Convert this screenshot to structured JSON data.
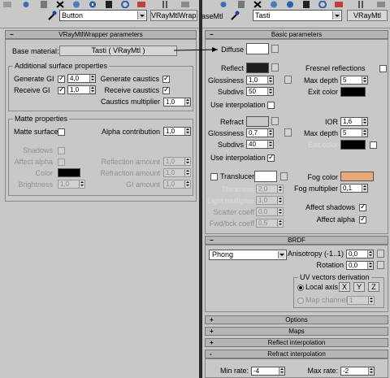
{
  "left": {
    "toolbar": {
      "name": "Button",
      "type_button": "VRayMtlWrapp"
    },
    "rollout_title": "VRayMtlWrapper parameters",
    "base_material": {
      "label": "Base material:",
      "button": "Tasti  ( VRayMtl )"
    },
    "additional": {
      "title": "Additional surface properties",
      "generate_gi": {
        "label": "Generate GI",
        "checked": true,
        "value": "4,0"
      },
      "receive_gi": {
        "label": "Receive GI",
        "checked": true,
        "value": "1,0"
      },
      "generate_caustics": {
        "label": "Generate caustics",
        "checked": true
      },
      "receive_caustics": {
        "label": "Receive caustics",
        "checked": true
      },
      "caustics_multiplier": {
        "label": "Caustics multiplier",
        "value": "1,0"
      }
    },
    "matte": {
      "title": "Matte properties",
      "matte_surface": {
        "label": "Matte surface",
        "checked": false
      },
      "alpha_contribution": {
        "label": "Alpha contribution",
        "value": "1,0"
      },
      "shadows": {
        "label": "Shadows"
      },
      "affect_alpha": {
        "label": "Affect alpha"
      },
      "color": {
        "label": "Color",
        "swatch": "#000000"
      },
      "brightness": {
        "label": "Brightness",
        "value": "1,0"
      },
      "reflection_amount": {
        "label": "Reflection amount",
        "value": "1,0"
      },
      "refraction_amount": {
        "label": "Refraction amount",
        "value": "1,0"
      },
      "gi_amount": {
        "label": "GI amount",
        "value": "1,0"
      }
    }
  },
  "right": {
    "toolbar": {
      "name": "Tasti",
      "type_button": "VRayMtl",
      "overlap_label": "BaseMtl"
    },
    "basic": {
      "title": "Basic parameters",
      "diffuse": {
        "label": "Diffuse",
        "swatch": "#ffffff"
      },
      "reflect": {
        "label": "Reflect",
        "swatch": "#1e1e1e"
      },
      "fresnel": {
        "label": "Fresnel reflections",
        "checked": false
      },
      "glossiness": {
        "label": "Glossiness",
        "value": "1,0"
      },
      "max_depth": {
        "label": "Max depth",
        "value": "5"
      },
      "subdivs": {
        "label": "Subdivs",
        "value": "50"
      },
      "exit_color": {
        "label": "Exit color",
        "swatch": "#000000"
      },
      "use_interpolation": {
        "label": "Use interpolation",
        "checked": false
      }
    },
    "refraction": {
      "refract": {
        "label": "Refract",
        "swatch": "#c8c8c8"
      },
      "ior": {
        "label": "IOR",
        "value": "1,6"
      },
      "glossiness": {
        "label": "Glossiness",
        "value": "0,7"
      },
      "max_depth": {
        "label": "Max depth",
        "value": "5"
      },
      "subdivs": {
        "label": "Subdivs",
        "value": "40"
      },
      "exit_color": {
        "label": "Exit color",
        "swatch": "#000000"
      },
      "use_interpolation": {
        "label": "Use interpolation",
        "checked": true
      }
    },
    "translucency": {
      "translucent": {
        "label": "Translucent",
        "checked": false,
        "swatch": "#ffffff"
      },
      "thickness": {
        "label": "Thickness",
        "value": "2,0"
      },
      "light_multiplier": {
        "label": "Light multiplier",
        "value": "1,0"
      },
      "scatter_coeff": {
        "label": "Scatter coeff",
        "value": "0,0"
      },
      "fwd_bck_coeff": {
        "label": "Fwd/bck coeff",
        "value": "0,5"
      },
      "fog_color": {
        "label": "Fog color",
        "swatch": "#e8a878"
      },
      "fog_multiplier": {
        "label": "Fog multiplier",
        "value": "0,1"
      },
      "affect_shadows": {
        "label": "Affect shadows",
        "checked": true
      },
      "affect_alpha": {
        "label": "Affect alpha",
        "checked": true
      }
    },
    "brdf": {
      "title": "BRDF",
      "type": "Phong",
      "anisotropy": {
        "label": "Anisotropy (-1..1)",
        "value": "0,0"
      },
      "rotation": {
        "label": "Rotation",
        "value": "0,0"
      },
      "uv": {
        "title": "UV vectors derivation",
        "local_axis": "Local axis",
        "axes": [
          "X",
          "Y",
          "Z"
        ],
        "map_channel": "Map channel",
        "map_channel_value": "1"
      }
    },
    "rollouts": [
      {
        "sign": "+",
        "label": "Options"
      },
      {
        "sign": "+",
        "label": "Maps"
      },
      {
        "sign": "+",
        "label": "Reflect interpolation"
      },
      {
        "sign": "-",
        "label": "Refract interpolation"
      }
    ],
    "refract_interp": {
      "min_rate": {
        "label": "Min rate:",
        "value": "-4"
      },
      "max_rate": {
        "label": "Max rate:",
        "value": "-2"
      }
    }
  },
  "icons": [
    "eyedropper-icon",
    "delete-icon",
    "material-sphere-icon",
    "assign-icon",
    "reset-icon"
  ]
}
